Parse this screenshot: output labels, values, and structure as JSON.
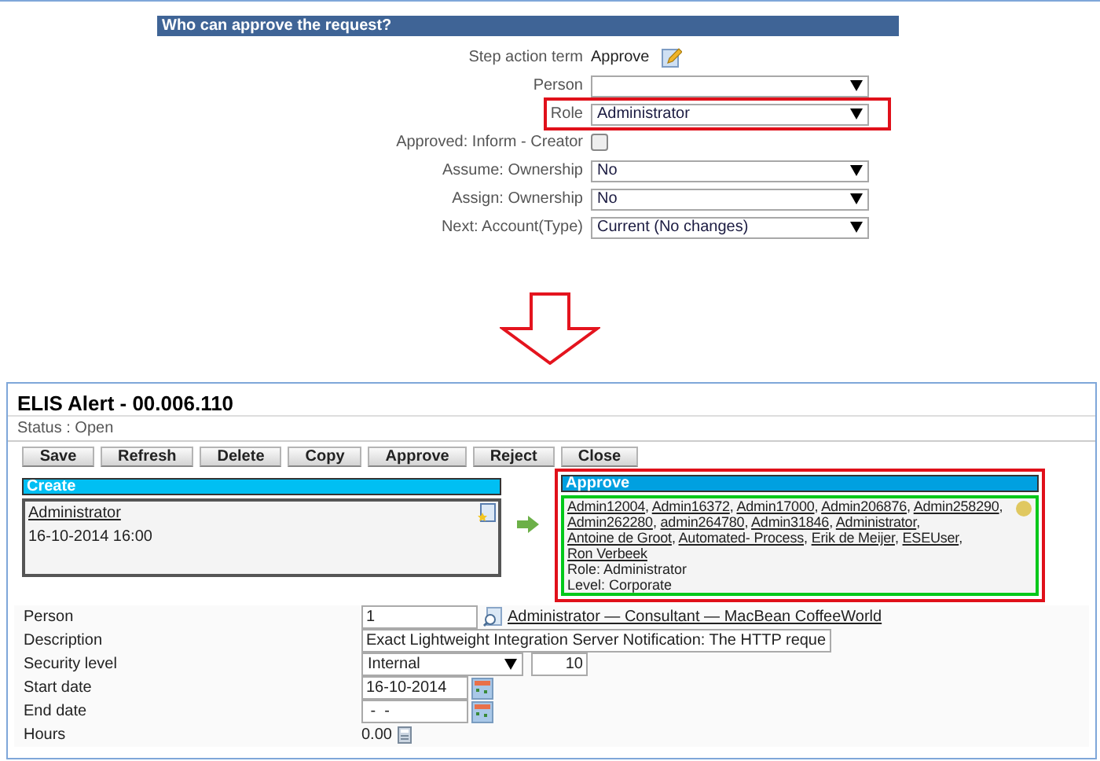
{
  "approval_setup": {
    "header": "Who can approve the request?",
    "rows": [
      {
        "kind": "text",
        "label": "Step action term",
        "value": "Approve",
        "highlighted": false
      },
      {
        "kind": "select",
        "label": "Person",
        "value": "",
        "highlighted": false
      },
      {
        "kind": "select",
        "label": "Role",
        "value": "Administrator",
        "highlighted": true
      },
      {
        "kind": "checkbox",
        "label": "Approved: Inform - Creator",
        "checked": false,
        "highlighted": false
      },
      {
        "kind": "select",
        "label": "Assume: Ownership",
        "value": "No",
        "highlighted": false
      },
      {
        "kind": "select",
        "label": "Assign: Ownership",
        "value": "No",
        "highlighted": false
      },
      {
        "kind": "select",
        "label": "Next: Account(Type)",
        "value": "Current (No changes)",
        "highlighted": false
      }
    ]
  },
  "request": {
    "title": "ELIS Alert - 00.006.110",
    "status": "Status : Open",
    "buttons": [
      "Save",
      "Refresh",
      "Delete",
      "Copy",
      "Approve",
      "Reject",
      "Close"
    ],
    "create": {
      "header": "Create",
      "author": "Administrator",
      "datetime": "16-10-2014 16:00"
    },
    "approve": {
      "header": "Approve",
      "separator": ",",
      "approvers": [
        "Admin12004",
        "Admin16372",
        "Admin17000",
        "Admin206876",
        "Admin258290",
        "Admin262280",
        "admin264780",
        "Admin31846",
        "Administrator",
        "Antoine de Groot",
        "Automated- Process",
        "Erik de Meijer",
        "ESEUser",
        "Ron Verbeek"
      ],
      "role": "Role: Administrator",
      "level": "Level: Corporate"
    },
    "fields": [
      {
        "kind": "person",
        "label": "Person",
        "value": "1",
        "link": "Administrator — Consultant — MacBean CoffeeWorld"
      },
      {
        "kind": "text",
        "label": "Description",
        "value": "Exact Lightweight Integration Server Notification: The HTTP reque"
      },
      {
        "kind": "security",
        "label": "Security level",
        "value": "Internal",
        "number": "10"
      },
      {
        "kind": "date",
        "label": "Start date",
        "value": "16-10-2014"
      },
      {
        "kind": "date",
        "label": "End date",
        "value": " -  -"
      },
      {
        "kind": "hours",
        "label": "Hours",
        "value": "0.00"
      }
    ]
  }
}
